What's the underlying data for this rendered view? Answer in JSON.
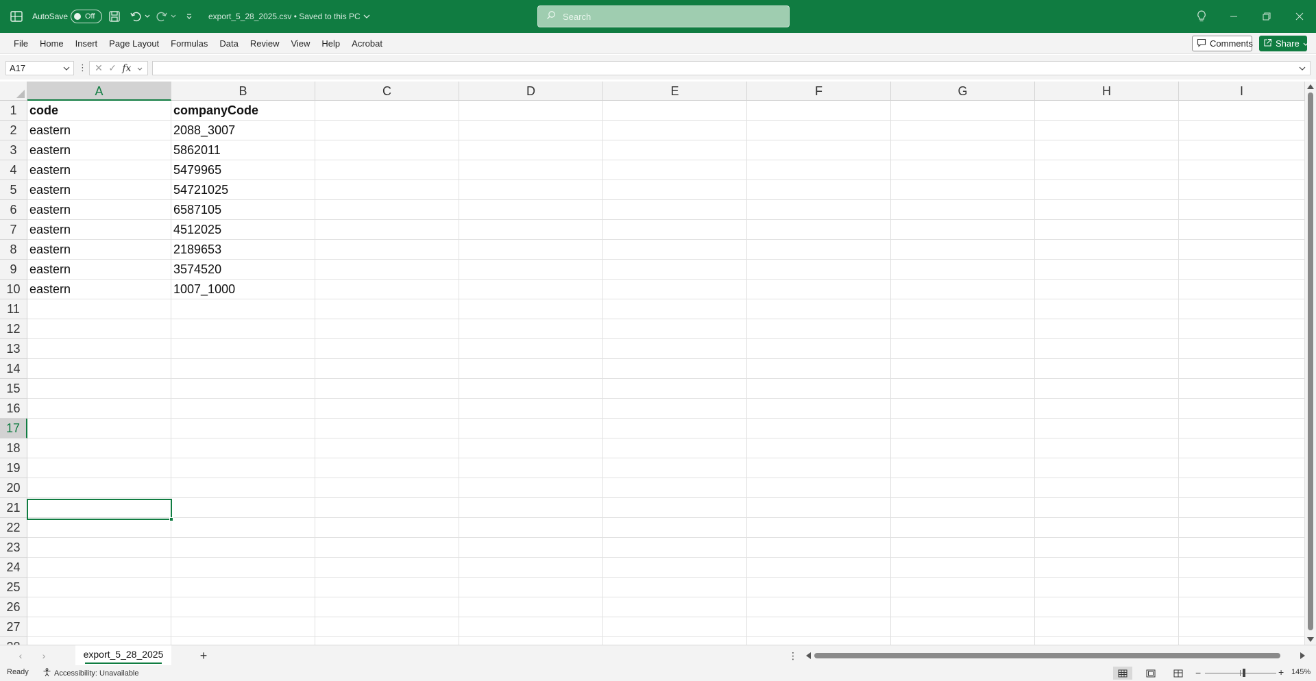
{
  "title_bar": {
    "autosave_label": "AutoSave",
    "autosave_state": "Off",
    "document_title": "export_5_28_2025.csv • Saved to this PC",
    "search_placeholder": "Search"
  },
  "menu": {
    "items": [
      "File",
      "Home",
      "Insert",
      "Page Layout",
      "Formulas",
      "Data",
      "Review",
      "View",
      "Help",
      "Acrobat"
    ],
    "comments_label": "Comments",
    "share_label": "Share"
  },
  "formula_bar": {
    "name_box": "A17",
    "formula": ""
  },
  "sheet": {
    "columns": [
      "A",
      "B",
      "C",
      "D",
      "E",
      "F",
      "G",
      "H",
      "I"
    ],
    "active_column": "A",
    "active_row": 17,
    "row_count": 28,
    "header_row": [
      "code",
      "companyCode"
    ],
    "rows": [
      [
        "eastern",
        "2088_3007"
      ],
      [
        "eastern",
        "5862011"
      ],
      [
        "eastern",
        "5479965"
      ],
      [
        "eastern",
        "54721025"
      ],
      [
        "eastern",
        "6587105"
      ],
      [
        "eastern",
        "4512025"
      ],
      [
        "eastern",
        "2189653"
      ],
      [
        "eastern",
        "3574520"
      ],
      [
        "eastern",
        "1007_1000"
      ]
    ]
  },
  "tabs": {
    "sheet_name": "export_5_28_2025"
  },
  "status_bar": {
    "ready": "Ready",
    "accessibility": "Accessibility: Unavailable",
    "zoom": "145%"
  },
  "colors": {
    "accent": "#107c41"
  },
  "icons": [
    "excel-app-icon",
    "save-icon",
    "undo-icon",
    "redo-icon",
    "search-icon",
    "lightbulb-icon",
    "comments-icon",
    "share-icon",
    "fx-icon",
    "accessibility-icon",
    "normal-view-icon",
    "page-layout-view-icon",
    "page-break-view-icon"
  ]
}
